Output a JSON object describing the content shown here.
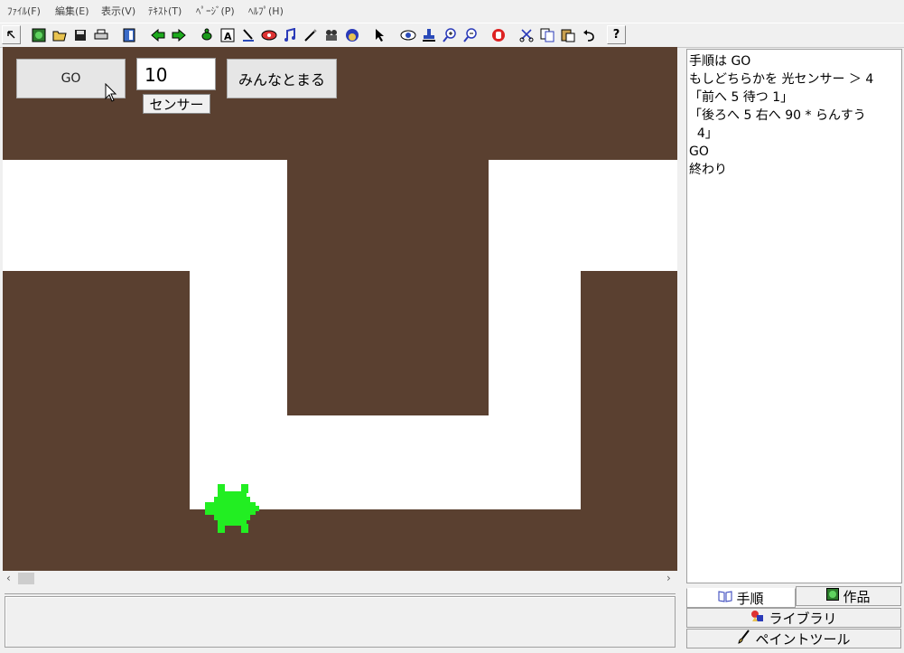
{
  "menu": {
    "items": [
      "ﾌｧｲﾙ(F)",
      "編集(E)",
      "表示(V)",
      "ﾃｷｽﾄ(T)",
      "ﾍﾟｰｼﾞ(P)",
      "ﾍﾙﾌﾟ(H)"
    ]
  },
  "toolbar": {
    "icons": [
      "pointer-icon",
      "globe-icon",
      "open-folder-icon",
      "save-icon",
      "print-icon",
      "page-icon",
      "back-arrow-icon",
      "forward-arrow-icon",
      "turtle-icon",
      "text-icon",
      "pen-icon",
      "eye-shape-icon",
      "music-icon",
      "wand-icon",
      "film-icon",
      "paint-icon",
      "cursor-icon",
      "eye-icon",
      "stamp-icon",
      "zoom-in-icon",
      "zoom-out-icon",
      "hand-icon",
      "cut-icon",
      "copy-icon",
      "paste-icon",
      "undo-icon",
      "help-icon"
    ],
    "help_glyph": "?"
  },
  "stage": {
    "go_label": "GO",
    "number_value": "10",
    "sensor_label": "センサー",
    "gather_label": "みんなとまる"
  },
  "code": {
    "lines": [
      "手順は GO",
      "もしどちらかを 光センサー ＞ 4",
      "「前へ 5 待つ 1」",
      "「後ろへ 5 右へ 90 * らんすう",
      "  4」",
      "GO",
      "終わり"
    ]
  },
  "tabs": {
    "procedure": "手順",
    "works": "作品",
    "library": "ライブラリ",
    "paint_tool": "ペイントツール"
  },
  "colors": {
    "ground": "#5a4030",
    "path": "#ffffff",
    "turtle": "#22ee22"
  }
}
